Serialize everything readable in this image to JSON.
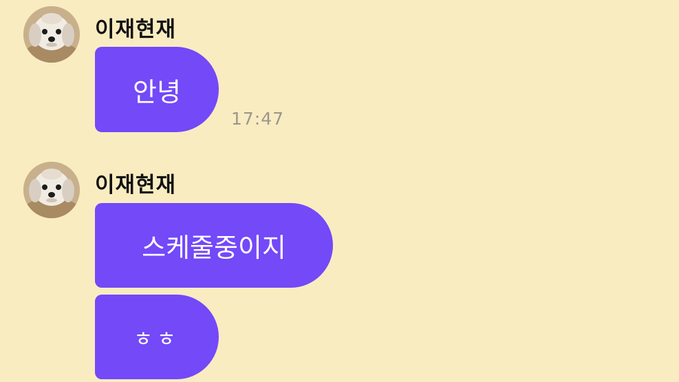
{
  "chat": {
    "colors": {
      "background": "#f9ecc1",
      "bubble": "#7349f8",
      "bubble_text": "#ffffff",
      "timestamp": "#9c978a",
      "sender": "#111111"
    },
    "groups": [
      {
        "sender": "이재현재",
        "avatar": "dog-avatar-icon",
        "messages": [
          {
            "text": "안녕",
            "time": "17:47"
          }
        ]
      },
      {
        "sender": "이재현재",
        "avatar": "dog-avatar-icon",
        "messages": [
          {
            "text": "스케줄중이지"
          },
          {
            "text": "ㅎㅎ"
          }
        ]
      }
    ]
  }
}
